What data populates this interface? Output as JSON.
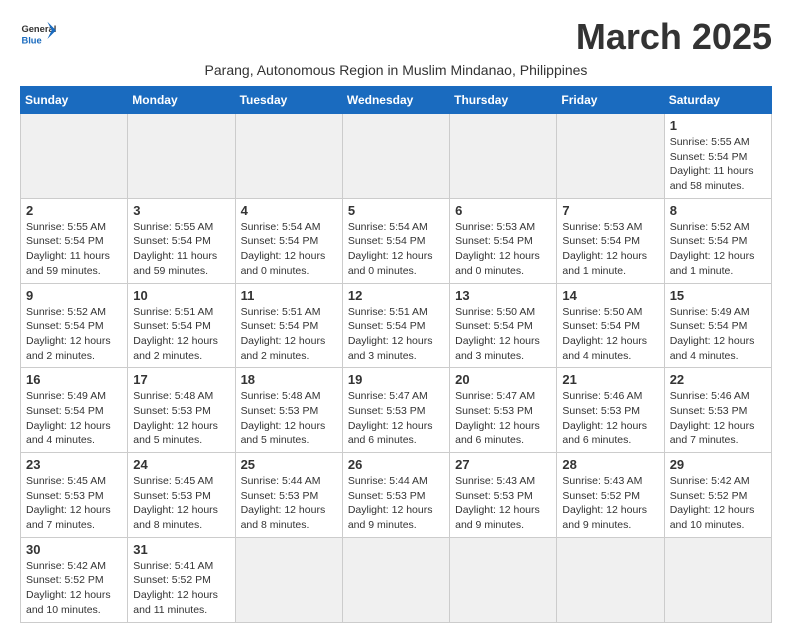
{
  "header": {
    "logo_general": "General",
    "logo_blue": "Blue",
    "month_title": "March 2025",
    "subtitle": "Parang, Autonomous Region in Muslim Mindanao, Philippines"
  },
  "days_of_week": [
    "Sunday",
    "Monday",
    "Tuesday",
    "Wednesday",
    "Thursday",
    "Friday",
    "Saturday"
  ],
  "weeks": [
    [
      {
        "day": "",
        "info": ""
      },
      {
        "day": "",
        "info": ""
      },
      {
        "day": "",
        "info": ""
      },
      {
        "day": "",
        "info": ""
      },
      {
        "day": "",
        "info": ""
      },
      {
        "day": "",
        "info": ""
      },
      {
        "day": "1",
        "info": "Sunrise: 5:55 AM\nSunset: 5:54 PM\nDaylight: 11 hours and 58 minutes."
      }
    ],
    [
      {
        "day": "2",
        "info": "Sunrise: 5:55 AM\nSunset: 5:54 PM\nDaylight: 11 hours and 59 minutes."
      },
      {
        "day": "3",
        "info": "Sunrise: 5:55 AM\nSunset: 5:54 PM\nDaylight: 11 hours and 59 minutes."
      },
      {
        "day": "4",
        "info": "Sunrise: 5:54 AM\nSunset: 5:54 PM\nDaylight: 12 hours and 0 minutes."
      },
      {
        "day": "5",
        "info": "Sunrise: 5:54 AM\nSunset: 5:54 PM\nDaylight: 12 hours and 0 minutes."
      },
      {
        "day": "6",
        "info": "Sunrise: 5:53 AM\nSunset: 5:54 PM\nDaylight: 12 hours and 0 minutes."
      },
      {
        "day": "7",
        "info": "Sunrise: 5:53 AM\nSunset: 5:54 PM\nDaylight: 12 hours and 1 minute."
      },
      {
        "day": "8",
        "info": "Sunrise: 5:52 AM\nSunset: 5:54 PM\nDaylight: 12 hours and 1 minute."
      }
    ],
    [
      {
        "day": "9",
        "info": "Sunrise: 5:52 AM\nSunset: 5:54 PM\nDaylight: 12 hours and 2 minutes."
      },
      {
        "day": "10",
        "info": "Sunrise: 5:51 AM\nSunset: 5:54 PM\nDaylight: 12 hours and 2 minutes."
      },
      {
        "day": "11",
        "info": "Sunrise: 5:51 AM\nSunset: 5:54 PM\nDaylight: 12 hours and 2 minutes."
      },
      {
        "day": "12",
        "info": "Sunrise: 5:51 AM\nSunset: 5:54 PM\nDaylight: 12 hours and 3 minutes."
      },
      {
        "day": "13",
        "info": "Sunrise: 5:50 AM\nSunset: 5:54 PM\nDaylight: 12 hours and 3 minutes."
      },
      {
        "day": "14",
        "info": "Sunrise: 5:50 AM\nSunset: 5:54 PM\nDaylight: 12 hours and 4 minutes."
      },
      {
        "day": "15",
        "info": "Sunrise: 5:49 AM\nSunset: 5:54 PM\nDaylight: 12 hours and 4 minutes."
      }
    ],
    [
      {
        "day": "16",
        "info": "Sunrise: 5:49 AM\nSunset: 5:54 PM\nDaylight: 12 hours and 4 minutes."
      },
      {
        "day": "17",
        "info": "Sunrise: 5:48 AM\nSunset: 5:53 PM\nDaylight: 12 hours and 5 minutes."
      },
      {
        "day": "18",
        "info": "Sunrise: 5:48 AM\nSunset: 5:53 PM\nDaylight: 12 hours and 5 minutes."
      },
      {
        "day": "19",
        "info": "Sunrise: 5:47 AM\nSunset: 5:53 PM\nDaylight: 12 hours and 6 minutes."
      },
      {
        "day": "20",
        "info": "Sunrise: 5:47 AM\nSunset: 5:53 PM\nDaylight: 12 hours and 6 minutes."
      },
      {
        "day": "21",
        "info": "Sunrise: 5:46 AM\nSunset: 5:53 PM\nDaylight: 12 hours and 6 minutes."
      },
      {
        "day": "22",
        "info": "Sunrise: 5:46 AM\nSunset: 5:53 PM\nDaylight: 12 hours and 7 minutes."
      }
    ],
    [
      {
        "day": "23",
        "info": "Sunrise: 5:45 AM\nSunset: 5:53 PM\nDaylight: 12 hours and 7 minutes."
      },
      {
        "day": "24",
        "info": "Sunrise: 5:45 AM\nSunset: 5:53 PM\nDaylight: 12 hours and 8 minutes."
      },
      {
        "day": "25",
        "info": "Sunrise: 5:44 AM\nSunset: 5:53 PM\nDaylight: 12 hours and 8 minutes."
      },
      {
        "day": "26",
        "info": "Sunrise: 5:44 AM\nSunset: 5:53 PM\nDaylight: 12 hours and 9 minutes."
      },
      {
        "day": "27",
        "info": "Sunrise: 5:43 AM\nSunset: 5:53 PM\nDaylight: 12 hours and 9 minutes."
      },
      {
        "day": "28",
        "info": "Sunrise: 5:43 AM\nSunset: 5:52 PM\nDaylight: 12 hours and 9 minutes."
      },
      {
        "day": "29",
        "info": "Sunrise: 5:42 AM\nSunset: 5:52 PM\nDaylight: 12 hours and 10 minutes."
      }
    ],
    [
      {
        "day": "30",
        "info": "Sunrise: 5:42 AM\nSunset: 5:52 PM\nDaylight: 12 hours and 10 minutes."
      },
      {
        "day": "31",
        "info": "Sunrise: 5:41 AM\nSunset: 5:52 PM\nDaylight: 12 hours and 11 minutes."
      },
      {
        "day": "",
        "info": ""
      },
      {
        "day": "",
        "info": ""
      },
      {
        "day": "",
        "info": ""
      },
      {
        "day": "",
        "info": ""
      },
      {
        "day": "",
        "info": ""
      }
    ]
  ]
}
